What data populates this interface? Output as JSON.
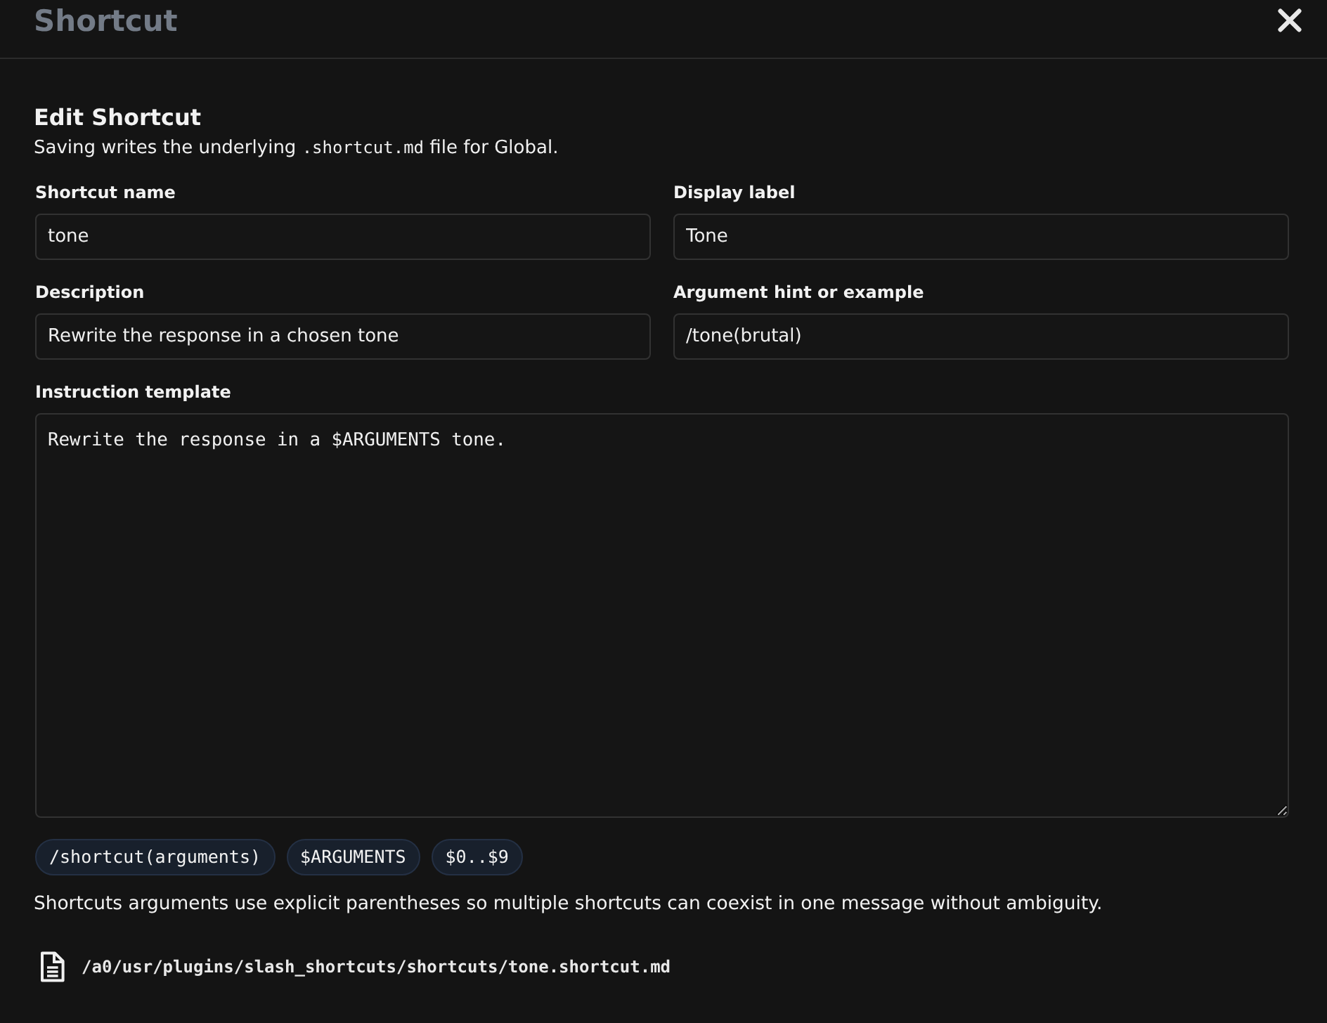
{
  "dialog": {
    "title": "Shortcut"
  },
  "form": {
    "heading": "Edit Shortcut",
    "subtitle": {
      "before": "Saving writes the underlying",
      "code": ".shortcut.md",
      "after": "file for Global."
    },
    "fields": [
      {
        "label": "Shortcut name",
        "value": "tone"
      },
      {
        "label": "Display label",
        "value": "Tone"
      },
      {
        "label": "Description",
        "value": "Rewrite the response in a chosen tone"
      },
      {
        "label": "Argument hint or example",
        "value": "/tone(brutal)"
      }
    ],
    "template": {
      "label": "Instruction template",
      "value": "Rewrite the response in a $ARGUMENTS tone."
    },
    "chips": [
      "/shortcut(arguments)",
      "$ARGUMENTS",
      "$0..$9"
    ],
    "note": "Shortcuts arguments use explicit parentheses so multiple shortcuts can coexist in one message without ambiguity.",
    "file_path": "/a0/usr/plugins/slash_shortcuts/shortcuts/tone.shortcut.md"
  }
}
